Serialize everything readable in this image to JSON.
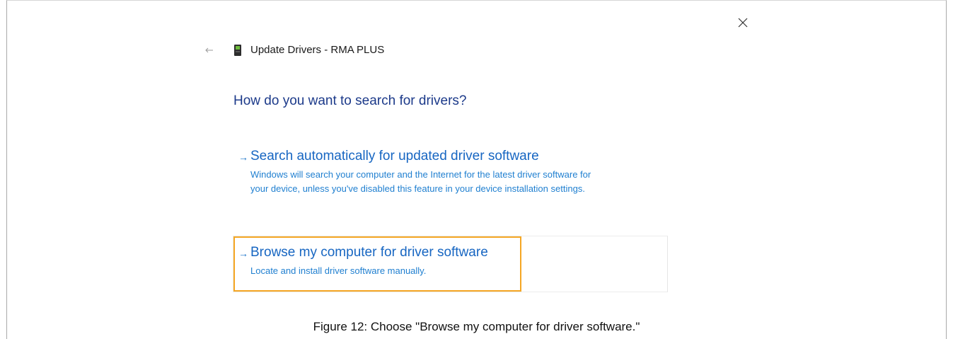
{
  "dialog": {
    "title": "Update Drivers - RMA PLUS",
    "icons": {
      "back": "back-arrow-icon",
      "device": "device-icon",
      "close": "close-icon"
    },
    "heading": "How do you want to search for drivers?",
    "options": [
      {
        "title": "Search automatically for updated driver software",
        "description_line1": "Windows will search your computer and the Internet for the latest driver software for",
        "description_line2": "your device, unless you've disabled this feature in your device installation settings."
      },
      {
        "title": "Browse my computer for driver software",
        "description_line1": "Locate and install driver software manually."
      }
    ]
  },
  "caption": "Figure 12: Choose \"Browse my computer for driver software.\"",
  "colors": {
    "heading": "#1c3a8a",
    "link": "#1766c2",
    "highlight": "#f5a623"
  }
}
